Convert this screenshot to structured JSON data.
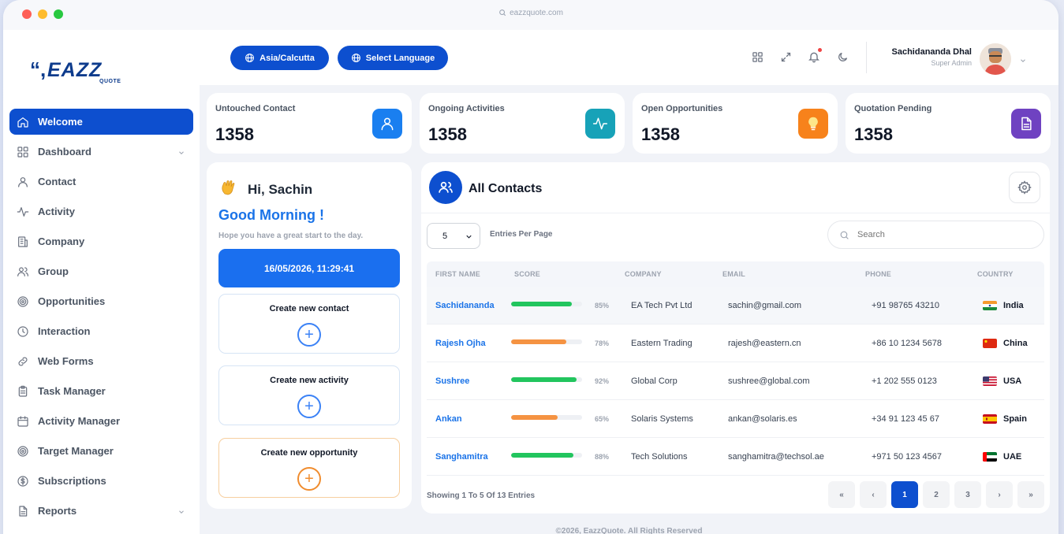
{
  "window": {
    "url": "eazzquote.com"
  },
  "logo": {
    "mark": "EAZZ",
    "tag": "QUOTE"
  },
  "sidebar": {
    "items": [
      {
        "label": "Welcome",
        "icon": "home-icon",
        "active": true
      },
      {
        "label": "Dashboard",
        "icon": "grid-icon",
        "chevron": true
      },
      {
        "label": "Contact",
        "icon": "user-icon"
      },
      {
        "label": "Activity",
        "icon": "activity-icon"
      },
      {
        "label": "Company",
        "icon": "building-icon"
      },
      {
        "label": "Group",
        "icon": "users-icon"
      },
      {
        "label": "Opportunities",
        "icon": "target-icon"
      },
      {
        "label": "Interaction",
        "icon": "clock-icon"
      },
      {
        "label": "Web Forms",
        "icon": "link-icon"
      },
      {
        "label": "Task Manager",
        "icon": "clipboard-icon"
      },
      {
        "label": "Activity Manager",
        "icon": "calendar-icon"
      },
      {
        "label": "Target Manager",
        "icon": "target-icon"
      },
      {
        "label": "Subscriptions",
        "icon": "dollar-icon"
      },
      {
        "label": "Reports",
        "icon": "file-icon",
        "chevron": true
      }
    ]
  },
  "topbar": {
    "timezone": "Asia/Calcutta",
    "language": "Select Language",
    "user_name": "Sachidananda Dhal",
    "user_role": "Super Admin"
  },
  "stats": [
    {
      "label": "Untouched Contact",
      "value": "1358",
      "icon": "user-icon",
      "color": "#1a7ff0"
    },
    {
      "label": "Ongoing Activities",
      "value": "1358",
      "icon": "activity-icon",
      "color": "#17a2b8"
    },
    {
      "label": "Open Opportunities",
      "value": "1358",
      "icon": "bulb-icon",
      "color": "#f7821b"
    },
    {
      "label": "Quotation Pending",
      "value": "1358",
      "icon": "document-icon",
      "color": "#6f42c1"
    }
  ],
  "welcome": {
    "greeting": "Hi, Sachin",
    "salutation": "Good Morning !",
    "message": "Hope you have a great start to the day.",
    "datetime": "16/05/2026, 11:29:41",
    "actions": [
      "Create new contact",
      "Create new activity",
      "Create new opportunity"
    ]
  },
  "contacts": {
    "title": "All Contacts",
    "per_page": "5",
    "per_page_label": "Entries Per Page",
    "search_placeholder": "Search",
    "columns": [
      "FIRST NAME",
      "SCORE",
      "COMPANY",
      "EMAIL",
      "PHONE",
      "COUNTRY"
    ],
    "rows": [
      {
        "name": "Sachidananda",
        "score": 85,
        "score_label": "85%",
        "company": "EA Tech Pvt Ltd",
        "email": "sachin@gmail.com",
        "phone": "+91 98765 43210",
        "country": "India",
        "score_color": "#22c55e"
      },
      {
        "name": "Rajesh Ojha",
        "score": 78,
        "score_label": "78%",
        "company": "Eastern Trading",
        "email": "rajesh@eastern.cn",
        "phone": "+86 10 1234 5678",
        "country": "China",
        "score_color": "#f59342"
      },
      {
        "name": "Sushree",
        "score": 92,
        "score_label": "92%",
        "company": "Global Corp",
        "email": "sushree@global.com",
        "phone": "+1 202 555 0123",
        "country": "USA",
        "score_color": "#22c55e"
      },
      {
        "name": "Ankan",
        "score": 65,
        "score_label": "65%",
        "company": "Solaris Systems",
        "email": "ankan@solaris.es",
        "phone": "+34 91 123 45 67",
        "country": "Spain",
        "score_color": "#f59342"
      },
      {
        "name": "Sanghamitra",
        "score": 88,
        "score_label": "88%",
        "company": "Tech Solutions",
        "email": "sanghamitra@techsol.ae",
        "phone": "+971 50 123 4567",
        "country": "UAE",
        "score_color": "#22c55e"
      }
    ],
    "showing": "Showing 1 To 5 Of 13 Entries",
    "pager": [
      "«",
      "‹",
      "1",
      "2",
      "3",
      "›",
      "»"
    ],
    "current_page": "1"
  },
  "footer": "©2026, EazzQuote. All Rights Reserved"
}
